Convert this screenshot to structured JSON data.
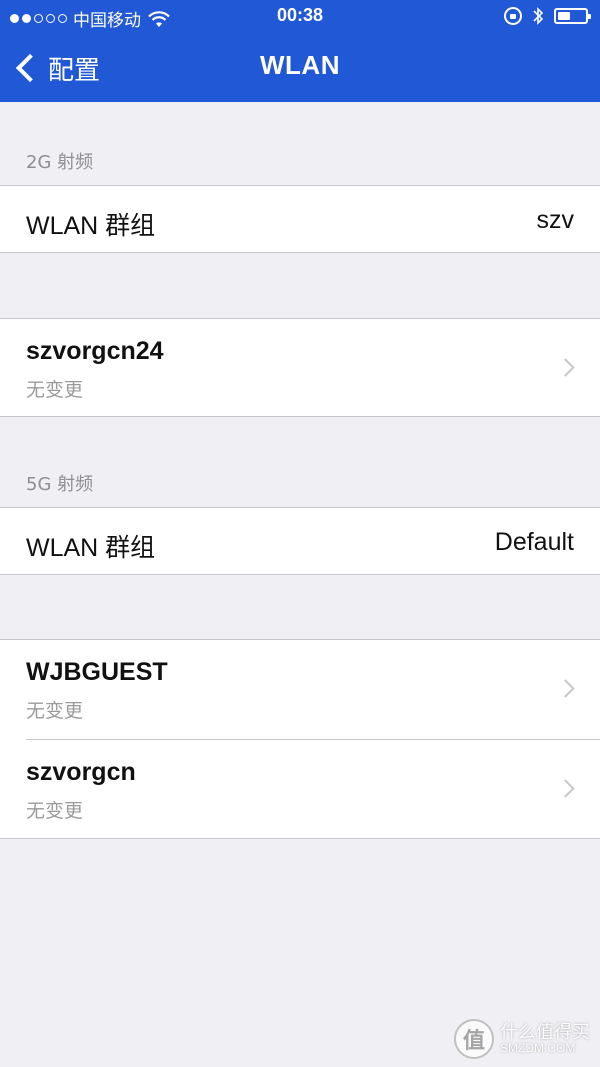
{
  "status_bar": {
    "carrier": "中国移动",
    "time": "00:38",
    "signal_bars_filled": 2,
    "signal_bars_total": 5,
    "battery_level": 0.4
  },
  "nav": {
    "back_label": "配置",
    "title": "WLAN"
  },
  "sections": {
    "band_2g": {
      "label": "2G 射频",
      "group_label": "WLAN 群组",
      "group_value": "szv",
      "networks": [
        {
          "name": "szvorgcn24",
          "status": "无变更"
        }
      ]
    },
    "band_5g": {
      "label": "5G 射频",
      "group_label": "WLAN 群组",
      "group_value": "Default",
      "networks": [
        {
          "name": "WJBGUEST",
          "status": "无变更"
        },
        {
          "name": "szvorgcn",
          "status": "无变更"
        }
      ]
    }
  },
  "watermark": {
    "cn": "什么值得买",
    "en": "SMZDM.COM"
  },
  "colors": {
    "nav_background": "#2158d6",
    "page_background": "#efeff4",
    "row_background": "#ffffff",
    "secondary_text": "#9b9b9b"
  }
}
